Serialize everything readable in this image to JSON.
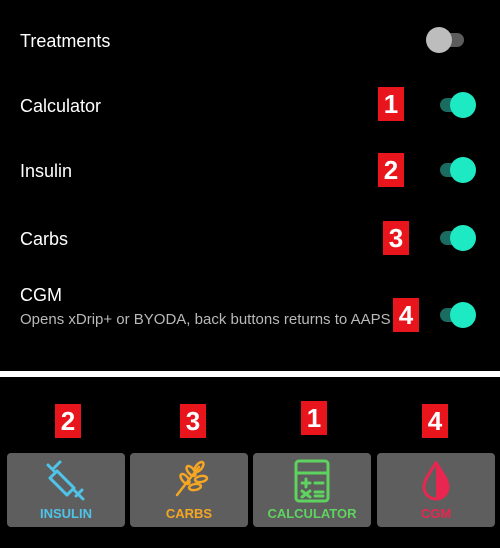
{
  "settings": {
    "rows": [
      {
        "label": "Treatments",
        "enabled": false
      },
      {
        "label": "Calculator",
        "enabled": true,
        "badge": "1"
      },
      {
        "label": "Insulin",
        "enabled": true,
        "badge": "2"
      },
      {
        "label": "Carbs",
        "enabled": true,
        "badge": "3"
      },
      {
        "label": "CGM",
        "description": "Opens xDrip+ or BYODA, back buttons returns to AAPS",
        "enabled": true,
        "badge": "4"
      }
    ]
  },
  "buttons": [
    {
      "label": "INSULIN",
      "badge": "2",
      "icon": "syringe-icon",
      "color": "#4fc3e8"
    },
    {
      "label": "CARBS",
      "badge": "3",
      "icon": "wheat-icon",
      "color": "#f5a623"
    },
    {
      "label": "CALCULATOR",
      "badge": "1",
      "icon": "calculator-icon",
      "color": "#5fd35f"
    },
    {
      "label": "CGM",
      "badge": "4",
      "icon": "blood-drop-icon",
      "color": "#e9264f"
    }
  ],
  "colors": {
    "background": "#000000",
    "switch_on": "#1de9c3",
    "switch_off": "#bdbdbd",
    "badge": "#e8161c",
    "tile": "#5e5e5e"
  }
}
